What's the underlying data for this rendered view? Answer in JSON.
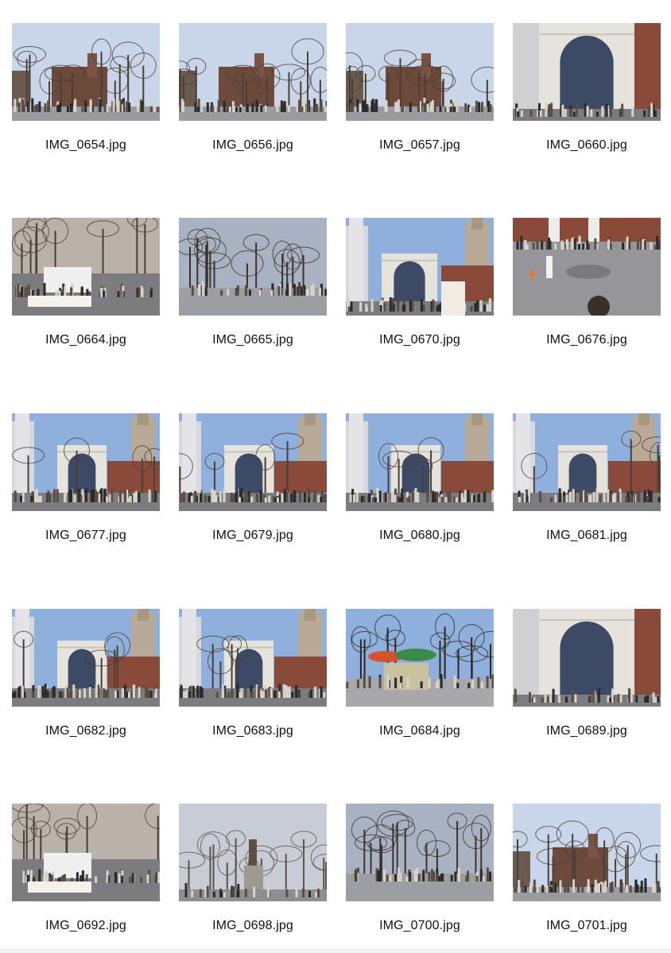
{
  "files": [
    {
      "name": "IMG_0654.jpg",
      "scene": "park-library"
    },
    {
      "name": "IMG_0656.jpg",
      "scene": "park-library"
    },
    {
      "name": "IMG_0657.jpg",
      "scene": "park-library"
    },
    {
      "name": "IMG_0660.jpg",
      "scene": "arch-close"
    },
    {
      "name": "IMG_0664.jpg",
      "scene": "vendors"
    },
    {
      "name": "IMG_0665.jpg",
      "scene": "trees-plaza"
    },
    {
      "name": "IMG_0670.jpg",
      "scene": "arch-wide"
    },
    {
      "name": "IMG_0676.jpg",
      "scene": "skater"
    },
    {
      "name": "IMG_0677.jpg",
      "scene": "arch-crowd"
    },
    {
      "name": "IMG_0679.jpg",
      "scene": "arch-crowd"
    },
    {
      "name": "IMG_0680.jpg",
      "scene": "arch-crowd"
    },
    {
      "name": "IMG_0681.jpg",
      "scene": "arch-crowd"
    },
    {
      "name": "IMG_0682.jpg",
      "scene": "arch-crowd"
    },
    {
      "name": "IMG_0683.jpg",
      "scene": "arch-crowd"
    },
    {
      "name": "IMG_0684.jpg",
      "scene": "food-cart"
    },
    {
      "name": "IMG_0689.jpg",
      "scene": "arch-close"
    },
    {
      "name": "IMG_0692.jpg",
      "scene": "vendors"
    },
    {
      "name": "IMG_0698.jpg",
      "scene": "statue"
    },
    {
      "name": "IMG_0700.jpg",
      "scene": "trees-plaza"
    },
    {
      "name": "IMG_0701.jpg",
      "scene": "park-library"
    }
  ],
  "colors": {
    "sky": "#8fb0dc",
    "sky_light": "#c9d6ea",
    "arch": "#e6e3dc",
    "brick": "#8a4a3a",
    "ground": "#7c7c80",
    "crowd": "#2b2b2e",
    "tree": "#4a3f36"
  }
}
